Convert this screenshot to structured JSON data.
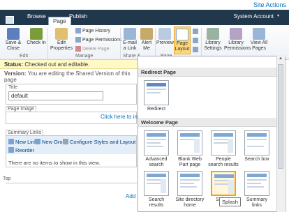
{
  "top": {
    "site_actions": "Site Actions"
  },
  "tabs": {
    "browse": "Browse",
    "page": "Page",
    "publish": "Publish"
  },
  "account": {
    "name": "System Account",
    "arrow": "▾"
  },
  "ribbon": {
    "save_close": "Save & Close",
    "check_in": "Check In",
    "edit_group": "Edit",
    "edit_properties": "Edit Properties",
    "page_history": "Page History",
    "page_permissions": "Page Permissions",
    "delete_page": "Delete Page",
    "manage_group": "Manage",
    "email_link": "E-mail a Link",
    "alert_me": "Alert Me",
    "share_group": "Share &",
    "preview": "Preview",
    "page_layout": "Page Layout",
    "library_settings": "Library Settings",
    "library_permissions": "Library Permissions",
    "view_all_pages": "View All Pages",
    "page_group": "Page"
  },
  "status": {
    "label": "Status:",
    "text": " Checked out and editable."
  },
  "version": {
    "label": "Version:",
    "text": " You are editing the Shared Version of this page"
  },
  "editor": {
    "title_label": "Title",
    "title_value": "default",
    "page_image_label": "Page Image",
    "insert_link": "Click here to insert a",
    "summary_label": "Summary Links",
    "new_link": "New Link",
    "new_group": "New Group",
    "configure": "Configure Styles and Layout",
    "reorder": "Reorder",
    "empty_text": "There are no items to show in this view.",
    "top_label": "Top",
    "add_link": "Add a"
  },
  "gallery": {
    "redirect_header": "Redirect Page",
    "redirect_items": [
      "Redirect"
    ],
    "welcome_header": "Welcome Page",
    "welcome_items": [
      "Advanced search",
      "Blank Web Part page",
      "People search results",
      "Search box",
      "Search results",
      "Site directory home",
      "Splash",
      "Summary links"
    ],
    "selected": "Splash",
    "tooltip": "Splash"
  },
  "colors": {
    "tab_bar": "#21374c",
    "status_bg": "#fff9c5",
    "link": "#0072bc",
    "selection": "#f0a30a"
  }
}
